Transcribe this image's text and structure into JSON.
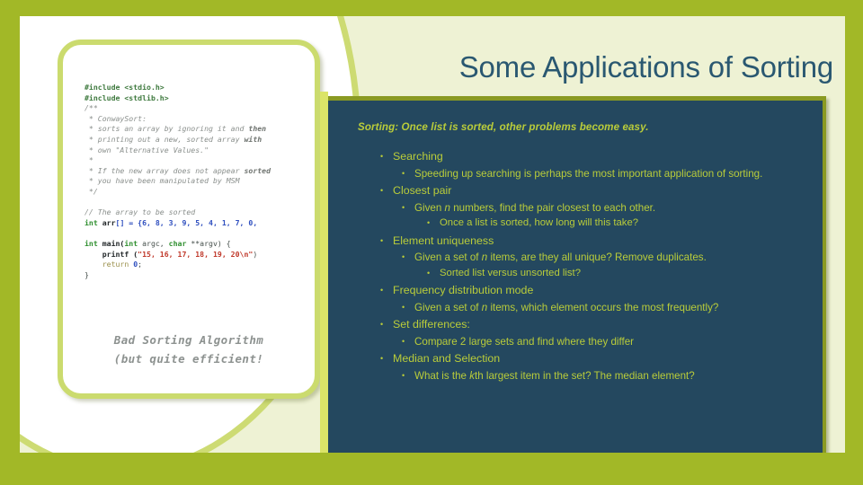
{
  "slide": {
    "title": "Some Applications of Sorting",
    "colors": {
      "frame": "#a2b827",
      "canvas": "#eef2d4",
      "panel": "#24485f",
      "panel_border": "#8a9a23",
      "title_text": "#2a5871",
      "body_text": "#b9cc3a",
      "card_border": "#cbdb6e",
      "strip": "#dbe468"
    }
  },
  "code_card": {
    "lines": [
      [
        {
          "t": "#include <stdio.h>",
          "c": "k-inc"
        }
      ],
      [
        {
          "t": "#include <stdlib.h>",
          "c": "k-inc"
        }
      ],
      [
        {
          "t": "/**",
          "c": "k-cmt"
        }
      ],
      [
        {
          "t": " * ConwaySort:",
          "c": "k-cmt"
        }
      ],
      [
        {
          "t": " * sorts an array by ignoring it and ",
          "c": "k-cmt"
        },
        {
          "t": "then",
          "c": "k-cmtb"
        }
      ],
      [
        {
          "t": " * printing out a new, sorted array ",
          "c": "k-cmt"
        },
        {
          "t": "with",
          "c": "k-cmtb"
        }
      ],
      [
        {
          "t": " * own \"Alternative Values.\"",
          "c": "k-cmt"
        }
      ],
      [
        {
          "t": " *",
          "c": "k-cmt"
        }
      ],
      [
        {
          "t": " * If the new array does not appear ",
          "c": "k-cmt"
        },
        {
          "t": "sorted",
          "c": "k-cmtb"
        }
      ],
      [
        {
          "t": " * you have been manipulated by MSM",
          "c": "k-cmt"
        }
      ],
      [
        {
          "t": " */",
          "c": "k-cmt"
        }
      ],
      [
        {
          "t": "",
          "c": "k-pl"
        }
      ],
      [
        {
          "t": "// The array to be sorted",
          "c": "k-cmt"
        }
      ],
      [
        {
          "t": "int ",
          "c": "k-type"
        },
        {
          "t": "arr",
          "c": "k-fn"
        },
        {
          "t": "[] = {",
          "c": "k-id"
        },
        {
          "t": "6, 8, 3, 9, 5, 4, 1, 7, 0,",
          "c": "k-num"
        }
      ],
      [
        {
          "t": "",
          "c": "k-pl"
        }
      ],
      [
        {
          "t": "int ",
          "c": "k-type"
        },
        {
          "t": "main(",
          "c": "k-fn"
        },
        {
          "t": "int ",
          "c": "k-type"
        },
        {
          "t": "argc, ",
          "c": "k-pl"
        },
        {
          "t": "char ",
          "c": "k-type"
        },
        {
          "t": "**argv) {",
          "c": "k-pl"
        }
      ],
      [
        {
          "t": "    printf (",
          "c": "k-fn"
        },
        {
          "t": "\"15, 16, 17, 18, 19, 20\\n\"",
          "c": "k-str"
        },
        {
          "t": ")",
          "c": "k-pl"
        }
      ],
      [
        {
          "t": "    return ",
          "c": "k-ret"
        },
        {
          "t": "0",
          "c": "k-num"
        },
        {
          "t": ";",
          "c": "k-pl"
        }
      ],
      [
        {
          "t": "}",
          "c": "k-pl"
        }
      ]
    ],
    "caption_line1": "Bad Sorting Algorithm",
    "caption_line2": "(but quite efficient!"
  },
  "content": {
    "lead": "Sorting: Once list is sorted, other problems become easy.",
    "bullet_glyph": "•",
    "items": [
      {
        "level": 1,
        "parts": [
          {
            "t": "Searching"
          }
        ]
      },
      {
        "level": 2,
        "parts": [
          {
            "t": "Speeding up searching is perhaps the most important application of sorting."
          }
        ]
      },
      {
        "level": 1,
        "parts": [
          {
            "t": "Closest pair"
          }
        ]
      },
      {
        "level": 2,
        "parts": [
          {
            "t": "Given "
          },
          {
            "t": "n",
            "i": true
          },
          {
            "t": " numbers, find the pair closest to each other."
          }
        ]
      },
      {
        "level": 3,
        "parts": [
          {
            "t": "Once a list is sorted, how long will this take?"
          }
        ]
      },
      {
        "level": 1,
        "parts": [
          {
            "t": "Element uniqueness"
          }
        ]
      },
      {
        "level": 2,
        "parts": [
          {
            "t": "Given a set of "
          },
          {
            "t": "n",
            "i": true
          },
          {
            "t": " items, are they all unique?  Remove duplicates."
          }
        ]
      },
      {
        "level": 3,
        "parts": [
          {
            "t": "Sorted list versus unsorted list?"
          }
        ]
      },
      {
        "level": 1,
        "parts": [
          {
            "t": "Frequency distribution mode"
          }
        ]
      },
      {
        "level": 2,
        "parts": [
          {
            "t": "Given a set of "
          },
          {
            "t": "n",
            "i": true
          },
          {
            "t": " items, which element occurs the most frequently?"
          }
        ]
      },
      {
        "level": 1,
        "parts": [
          {
            "t": "Set differences:"
          }
        ]
      },
      {
        "level": 2,
        "parts": [
          {
            "t": "Compare 2 large sets and find where they differ"
          }
        ]
      },
      {
        "level": 1,
        "parts": [
          {
            "t": "Median and Selection"
          }
        ]
      },
      {
        "level": 2,
        "parts": [
          {
            "t": "What is the "
          },
          {
            "t": "k",
            "i": true
          },
          {
            "t": "th largest item in the set?  The median element?"
          }
        ]
      }
    ]
  }
}
